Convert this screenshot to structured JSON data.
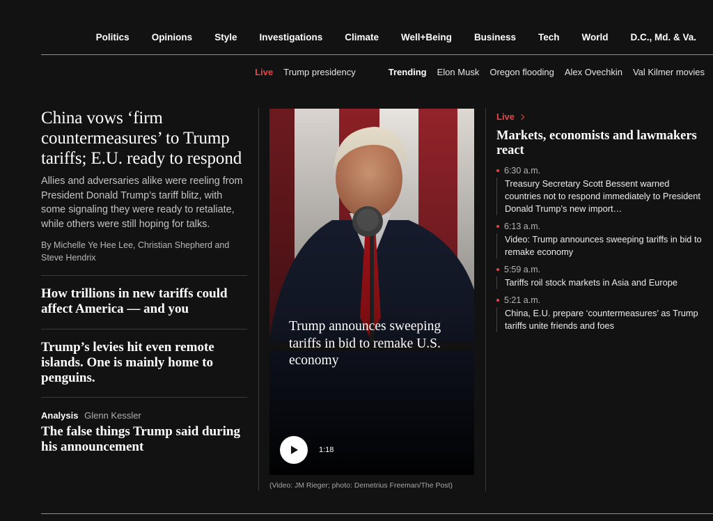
{
  "nav": {
    "items": [
      "Politics",
      "Opinions",
      "Style",
      "Investigations",
      "Climate",
      "Well+Being",
      "Business",
      "Tech",
      "World",
      "D.C., Md. & Va."
    ]
  },
  "trending_bar": {
    "live_label": "Live",
    "live_topic": "Trump presidency",
    "trending_label": "Trending",
    "items": [
      "Elon Musk",
      "Oregon flooding",
      "Alex Ovechkin",
      "Val Kilmer movies"
    ]
  },
  "lead": {
    "headline": "China vows ‘firm countermeasures’ to Trump tariffs; E.U. ready to respond",
    "blurb": "Allies and adversaries alike were reeling from President Donald Trump’s tariff blitz, with some signaling they were ready to retaliate, while others were still hoping for talks.",
    "byline": "By Michelle Ye Hee Lee, Christian Shepherd and Steve Hendrix"
  },
  "stories": [
    {
      "headline": "How trillions in new tariffs could affect America — and you"
    },
    {
      "headline": "Trump’s levies hit even remote islands. One is mainly home to penguins."
    },
    {
      "kicker": "Analysis",
      "author": "Glenn Kessler",
      "headline": "The false things Trump said during his announcement"
    }
  ],
  "media": {
    "headline": "Trump announces sweeping tariffs in bid to remake U.S. economy",
    "duration": "1:18",
    "caption": "(Video: JM Rieger; photo: Demetrius Freeman/The Post)"
  },
  "live_panel": {
    "label": "Live",
    "title": "Markets, economists and lawmakers react",
    "entries": [
      {
        "time": "6:30 a.m.",
        "text": "Treasury Secretary Scott Bessent warned countries not to respond immediately to President Donald Trump’s new import…"
      },
      {
        "time": "6:13 a.m.",
        "text": "Video: Trump announces sweeping tariffs in bid to remake economy"
      },
      {
        "time": "5:59 a.m.",
        "text": "Tariffs roil stock markets in Asia and Europe"
      },
      {
        "time": "5:21 a.m.",
        "text": "China, E.U. prepare ‘countermeasures’ as Trump tariffs unite friends and foes"
      }
    ]
  },
  "colors": {
    "background": "#121212",
    "live_red": "#e44545",
    "divider": "#3a3a3a"
  }
}
